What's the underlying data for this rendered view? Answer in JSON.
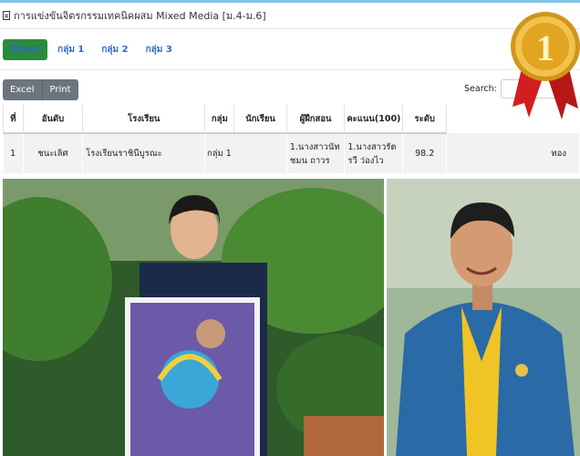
{
  "page": {
    "title": "การแข่งขันจิตรกรรมเทคนิคผสม Mixed Media [ม.4-ม.6]"
  },
  "tabs": [
    {
      "label": "ทั้งหมด",
      "active": true
    },
    {
      "label": "กลุ่ม 1",
      "active": false
    },
    {
      "label": "กลุ่ม 2",
      "active": false
    },
    {
      "label": "กลุ่ม 3",
      "active": false
    }
  ],
  "toolbar": {
    "excel_label": "Excel",
    "print_label": "Print",
    "search_label": "Search:"
  },
  "table": {
    "headers": [
      "ที่",
      "อันดับ",
      "โรงเรียน",
      "กลุ่ม",
      "นักเรียน",
      "ผู้ฝึกสอน",
      "คะแนน(100)",
      "ระดับ"
    ],
    "rows": [
      {
        "no": "1",
        "rank": "ชนะเลิศ",
        "school": "โรงเรียนราชินีบูรณะ",
        "group": "กลุ่ม 1",
        "student": "1.นางสาวนัทชมน ถาวร",
        "teacher": "1.นางสาวรัตรวี ว่องไว",
        "score": "98.2",
        "level": "ทอง"
      }
    ]
  },
  "medal": {
    "number": "1",
    "colors": {
      "gold": "#e2a520",
      "ribbon": "#d21e1e"
    }
  },
  "colors": {
    "active_tab": "#2b8a3e",
    "link": "#2a6ac8",
    "button": "#6c757d",
    "row_bg": "#f2f2f2"
  }
}
